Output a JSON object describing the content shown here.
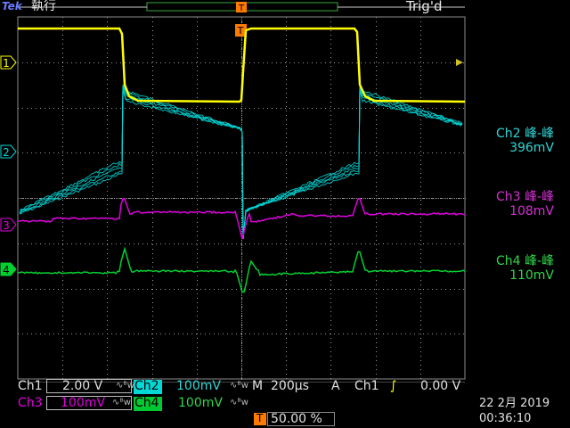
{
  "header": {
    "brand": "Tek",
    "state": "執行",
    "trigger_status": "Trig'd",
    "trigger_marker": "T"
  },
  "channels": [
    {
      "id": "1",
      "color": "#ffff00"
    },
    {
      "id": "2",
      "color": "#00d8d8"
    },
    {
      "id": "3",
      "color": "#e000e0"
    },
    {
      "id": "4",
      "color": "#00d030"
    }
  ],
  "measurements": [
    {
      "label": "Ch2 峰-峰",
      "value": "396mV",
      "color": "#2fd6d6"
    },
    {
      "label": "Ch3 峰-峰",
      "value": "108mV",
      "color": "#d62fd6"
    },
    {
      "label": "Ch4 峰-峰",
      "value": "110mV",
      "color": "#2fd64a"
    }
  ],
  "settings": {
    "ch1_label": "Ch1",
    "ch1_scale": "2.00 V",
    "ch2_label": "Ch2",
    "ch2_scale": "100mV",
    "ch3_label": "Ch3",
    "ch3_scale": "100mV",
    "ch4_label": "Ch4",
    "ch4_scale": "100mV",
    "bw_symbol": "∿ᴮw",
    "timebase_label": "M",
    "timebase": "200µs",
    "trigger_mode": "A",
    "trigger_source": "Ch1",
    "trigger_edge": "∫",
    "trigger_level": "0.00 V",
    "position_marker": "T",
    "position": "50.00 %"
  },
  "datetime": {
    "date": "22 2月  2019",
    "time": "00:36:10"
  },
  "colors": {
    "grid": "#9a9a9a",
    "ch1": "#ffff00",
    "ch2": "#00d8d8",
    "ch3": "#e000e0",
    "ch4": "#00d030"
  }
}
